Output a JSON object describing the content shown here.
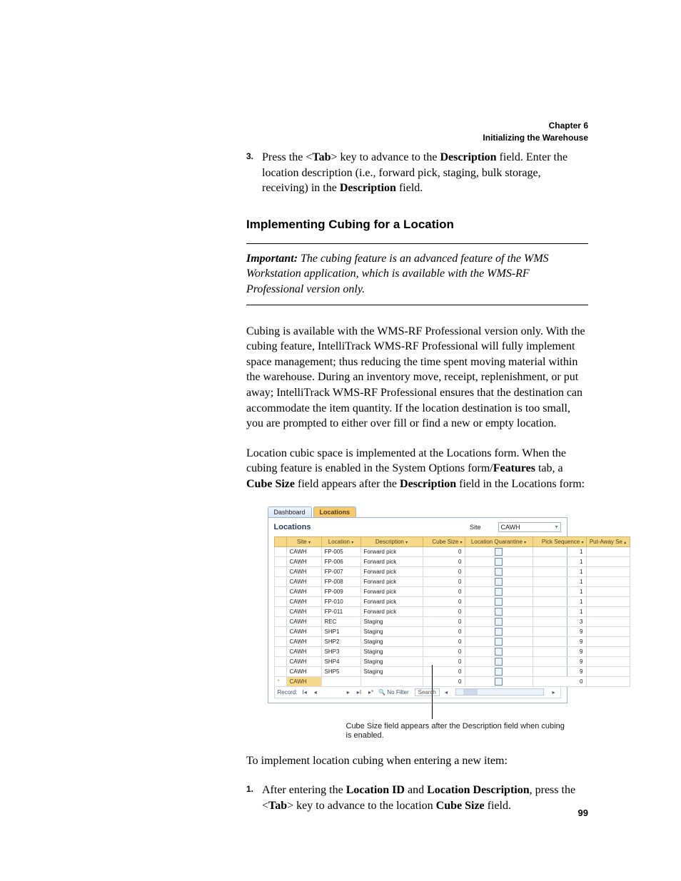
{
  "header": {
    "chapter": "Chapter 6",
    "title": "Initializing the Warehouse"
  },
  "step3": {
    "num": "3.",
    "t1": "Press the <",
    "tab": "Tab",
    "t2": "> key to advance to the ",
    "desc1": "Description",
    "t3": " field. Enter the location description (i.e., forward pick, staging, bulk storage, receiving) in the ",
    "desc2": "Description",
    "t4": " field."
  },
  "heading": "Implementing Cubing for a Location",
  "note": {
    "label": "Important:",
    "text": "   The cubing feature is an advanced feature of the WMS Workstation application, which is available with the WMS-RF Professional version only."
  },
  "para1": "Cubing is available with the WMS-RF Professional version only. With the cubing feature, IntelliTrack WMS-RF Professional will fully implement space management; thus reducing the time spent moving material within the warehouse. During an inventory move, receipt, replenishment, or put away; IntelliTrack WMS-RF Professional ensures that the destination can accommodate the item quantity. If the location destination is too small, you are prompted to either over fill or find a new or empty location.",
  "para2": {
    "t1": "Location cubic space is implemented at the Locations form. When the cubing feature is enabled in the System Options form/",
    "b1": "Features",
    "t2": " tab, a ",
    "b2": "Cube Size",
    "t3": " field appears after the ",
    "b3": "Description",
    "t4": " field in the Locations form:"
  },
  "fig": {
    "tab_dashboard": "Dashboard",
    "tab_locations": "Locations",
    "panel_title": "Locations",
    "site_label": "Site",
    "site_value": "CAWH",
    "cols": {
      "site": "Site",
      "loc": "Location",
      "desc": "Description",
      "cube": "Cube Size",
      "quar": "Location Quarantine",
      "pick": "Pick Sequence",
      "put": "Put-Away Se"
    },
    "rows": [
      {
        "site": "CAWH",
        "loc": "FP-005",
        "desc": "Forward pick",
        "cube": "0",
        "pick": "1"
      },
      {
        "site": "CAWH",
        "loc": "FP-006",
        "desc": "Forward pick",
        "cube": "0",
        "pick": "1"
      },
      {
        "site": "CAWH",
        "loc": "FP-007",
        "desc": "Forward pick",
        "cube": "0",
        "pick": "1"
      },
      {
        "site": "CAWH",
        "loc": "FP-008",
        "desc": "Forward pick",
        "cube": "0",
        "pick": "1"
      },
      {
        "site": "CAWH",
        "loc": "FP-009",
        "desc": "Forward pick",
        "cube": "0",
        "pick": "1"
      },
      {
        "site": "CAWH",
        "loc": "FP-010",
        "desc": "Forward pick",
        "cube": "0",
        "pick": "1"
      },
      {
        "site": "CAWH",
        "loc": "FP-011",
        "desc": "Forward pick",
        "cube": "0",
        "pick": "1"
      },
      {
        "site": "CAWH",
        "loc": "REC",
        "desc": "Staging",
        "cube": "0",
        "pick": "3"
      },
      {
        "site": "CAWH",
        "loc": "SHP1",
        "desc": "Staging",
        "cube": "0",
        "pick": "9"
      },
      {
        "site": "CAWH",
        "loc": "SHP2",
        "desc": "Staging",
        "cube": "0",
        "pick": "9"
      },
      {
        "site": "CAWH",
        "loc": "SHP3",
        "desc": "Staging",
        "cube": "0",
        "pick": "9"
      },
      {
        "site": "CAWH",
        "loc": "SHP4",
        "desc": "Staging",
        "cube": "0",
        "pick": "9"
      },
      {
        "site": "CAWH",
        "loc": "SHP5",
        "desc": "Staging",
        "cube": "0",
        "pick": "9"
      }
    ],
    "newrow": {
      "site": "CAWH",
      "cube": "0",
      "pick": "0"
    },
    "footer": {
      "record": "Record:",
      "nofilter": "No Filter",
      "search": "Search"
    }
  },
  "callout": "Cube Size field appears after the Description field when cubing is enabled.",
  "intro2": "To implement location cubing when entering a new item:",
  "step1b": {
    "num": "1.",
    "t1": "After entering the ",
    "b1": "Location ID",
    "t2": " and ",
    "b2": "Location Description",
    "t3": ", press the <",
    "tab": "Tab",
    "t4": "> key to advance to the location ",
    "b3": "Cube Size",
    "t5": " field."
  },
  "page_number": "99"
}
